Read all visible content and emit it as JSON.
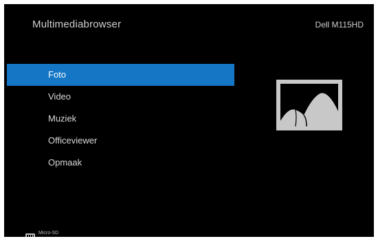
{
  "header": {
    "title": "Multimediabrowser",
    "device": "Dell M115HD"
  },
  "menu": {
    "items": [
      {
        "label": "Foto",
        "selected": true
      },
      {
        "label": "Video",
        "selected": false
      },
      {
        "label": "Muziek",
        "selected": false
      },
      {
        "label": "Officeviewer",
        "selected": false
      },
      {
        "label": "Opmaak",
        "selected": false
      }
    ]
  },
  "preview": {
    "icon": "photo-icon"
  },
  "footer": {
    "storage_icon": "sd-card-icon",
    "storage_label": "Micro-SD"
  },
  "colors": {
    "background": "#000000",
    "highlight": "#1476c5",
    "text": "#d8d8d8",
    "icon_gray": "#c8c8c8"
  }
}
